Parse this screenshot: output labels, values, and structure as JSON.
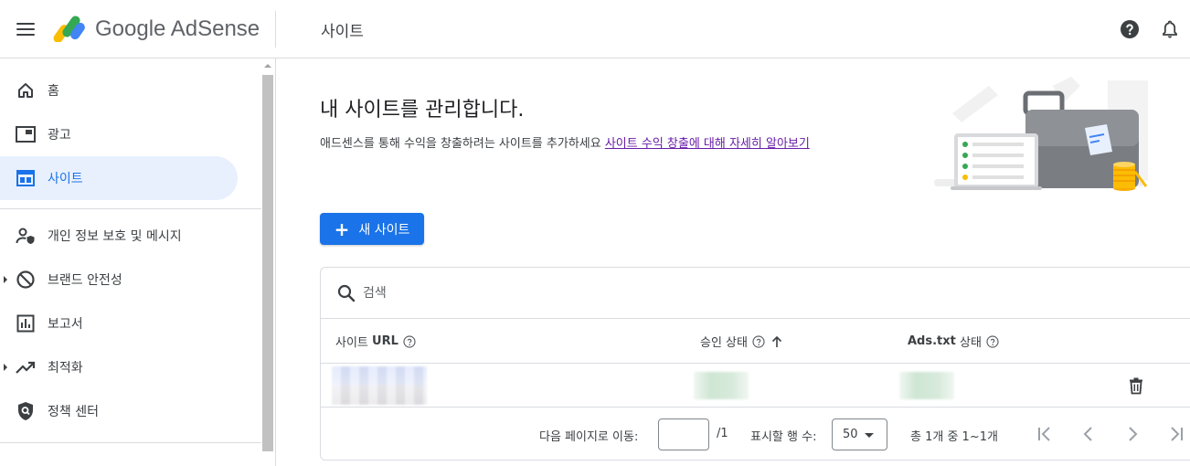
{
  "header": {
    "brand": "Google AdSense",
    "page_title": "사이트"
  },
  "sidebar": {
    "items": [
      {
        "label": "홈",
        "icon": "home-icon"
      },
      {
        "label": "광고",
        "icon": "ads-icon"
      },
      {
        "label": "사이트",
        "icon": "sites-icon",
        "active": true
      },
      {
        "label": "개인 정보 보호 및 메시지",
        "icon": "privacy-messaging-icon"
      },
      {
        "label": "브랜드 안전성",
        "icon": "block-icon",
        "expandable": true
      },
      {
        "label": "보고서",
        "icon": "reports-icon"
      },
      {
        "label": "최적화",
        "icon": "trending-up-icon",
        "expandable": true
      },
      {
        "label": "정책 센터",
        "icon": "policy-shield-icon"
      }
    ]
  },
  "main": {
    "heading": "내 사이트를 관리합니다.",
    "subtext": "애드센스를 통해 수익을 창출하려는 사이트를 추가하세요",
    "learn_more_link": "사이트 수익 창출에 대해 자세히 알아보기",
    "new_site_button": "새 사이트",
    "search": {
      "placeholder": "검색",
      "value": ""
    },
    "table": {
      "columns": [
        {
          "label_prefix": "사이트",
          "label_bold": "URL",
          "help": true
        },
        {
          "label_prefix": "승인 상태",
          "label_bold": "",
          "help": true,
          "sorted": "ascending"
        },
        {
          "label_prefix": "상태",
          "label_bold": "Ads.txt",
          "help": true
        }
      ],
      "rows": [
        {
          "site_url": "",
          "approval_status": "",
          "ads_txt_status": "",
          "redacted": true
        }
      ]
    },
    "pagination": {
      "goto_label": "다음 페이지로 이동:",
      "page_input_value": "",
      "total_pages": "/1",
      "rows_label": "표시할 행 수:",
      "rows_per_page": "50",
      "range_text": "총 1개 중 1~1개"
    }
  },
  "colors": {
    "accent": "#1a73e8",
    "active_nav_bg": "#e8f0fe",
    "link_visited": "#681da8"
  }
}
